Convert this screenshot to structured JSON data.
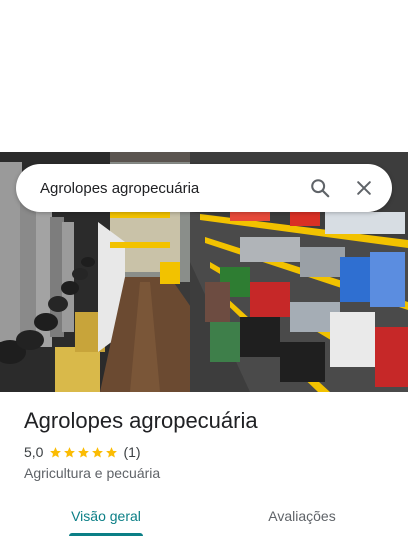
{
  "search": {
    "query": "Agrolopes agropecuária",
    "search_icon": "search-icon",
    "close_icon": "close-icon"
  },
  "place": {
    "name": "Agrolopes agropecuária",
    "rating": "5,0",
    "stars": 5,
    "review_count": "(1)",
    "category": "Agricultura e pecuária"
  },
  "tabs": [
    {
      "label": "Visão geral",
      "active": true
    },
    {
      "label": "Avaliações",
      "active": false
    }
  ],
  "colors": {
    "accent": "#0b7f86",
    "star": "#fbbc04",
    "shelf": "#f2c200"
  }
}
